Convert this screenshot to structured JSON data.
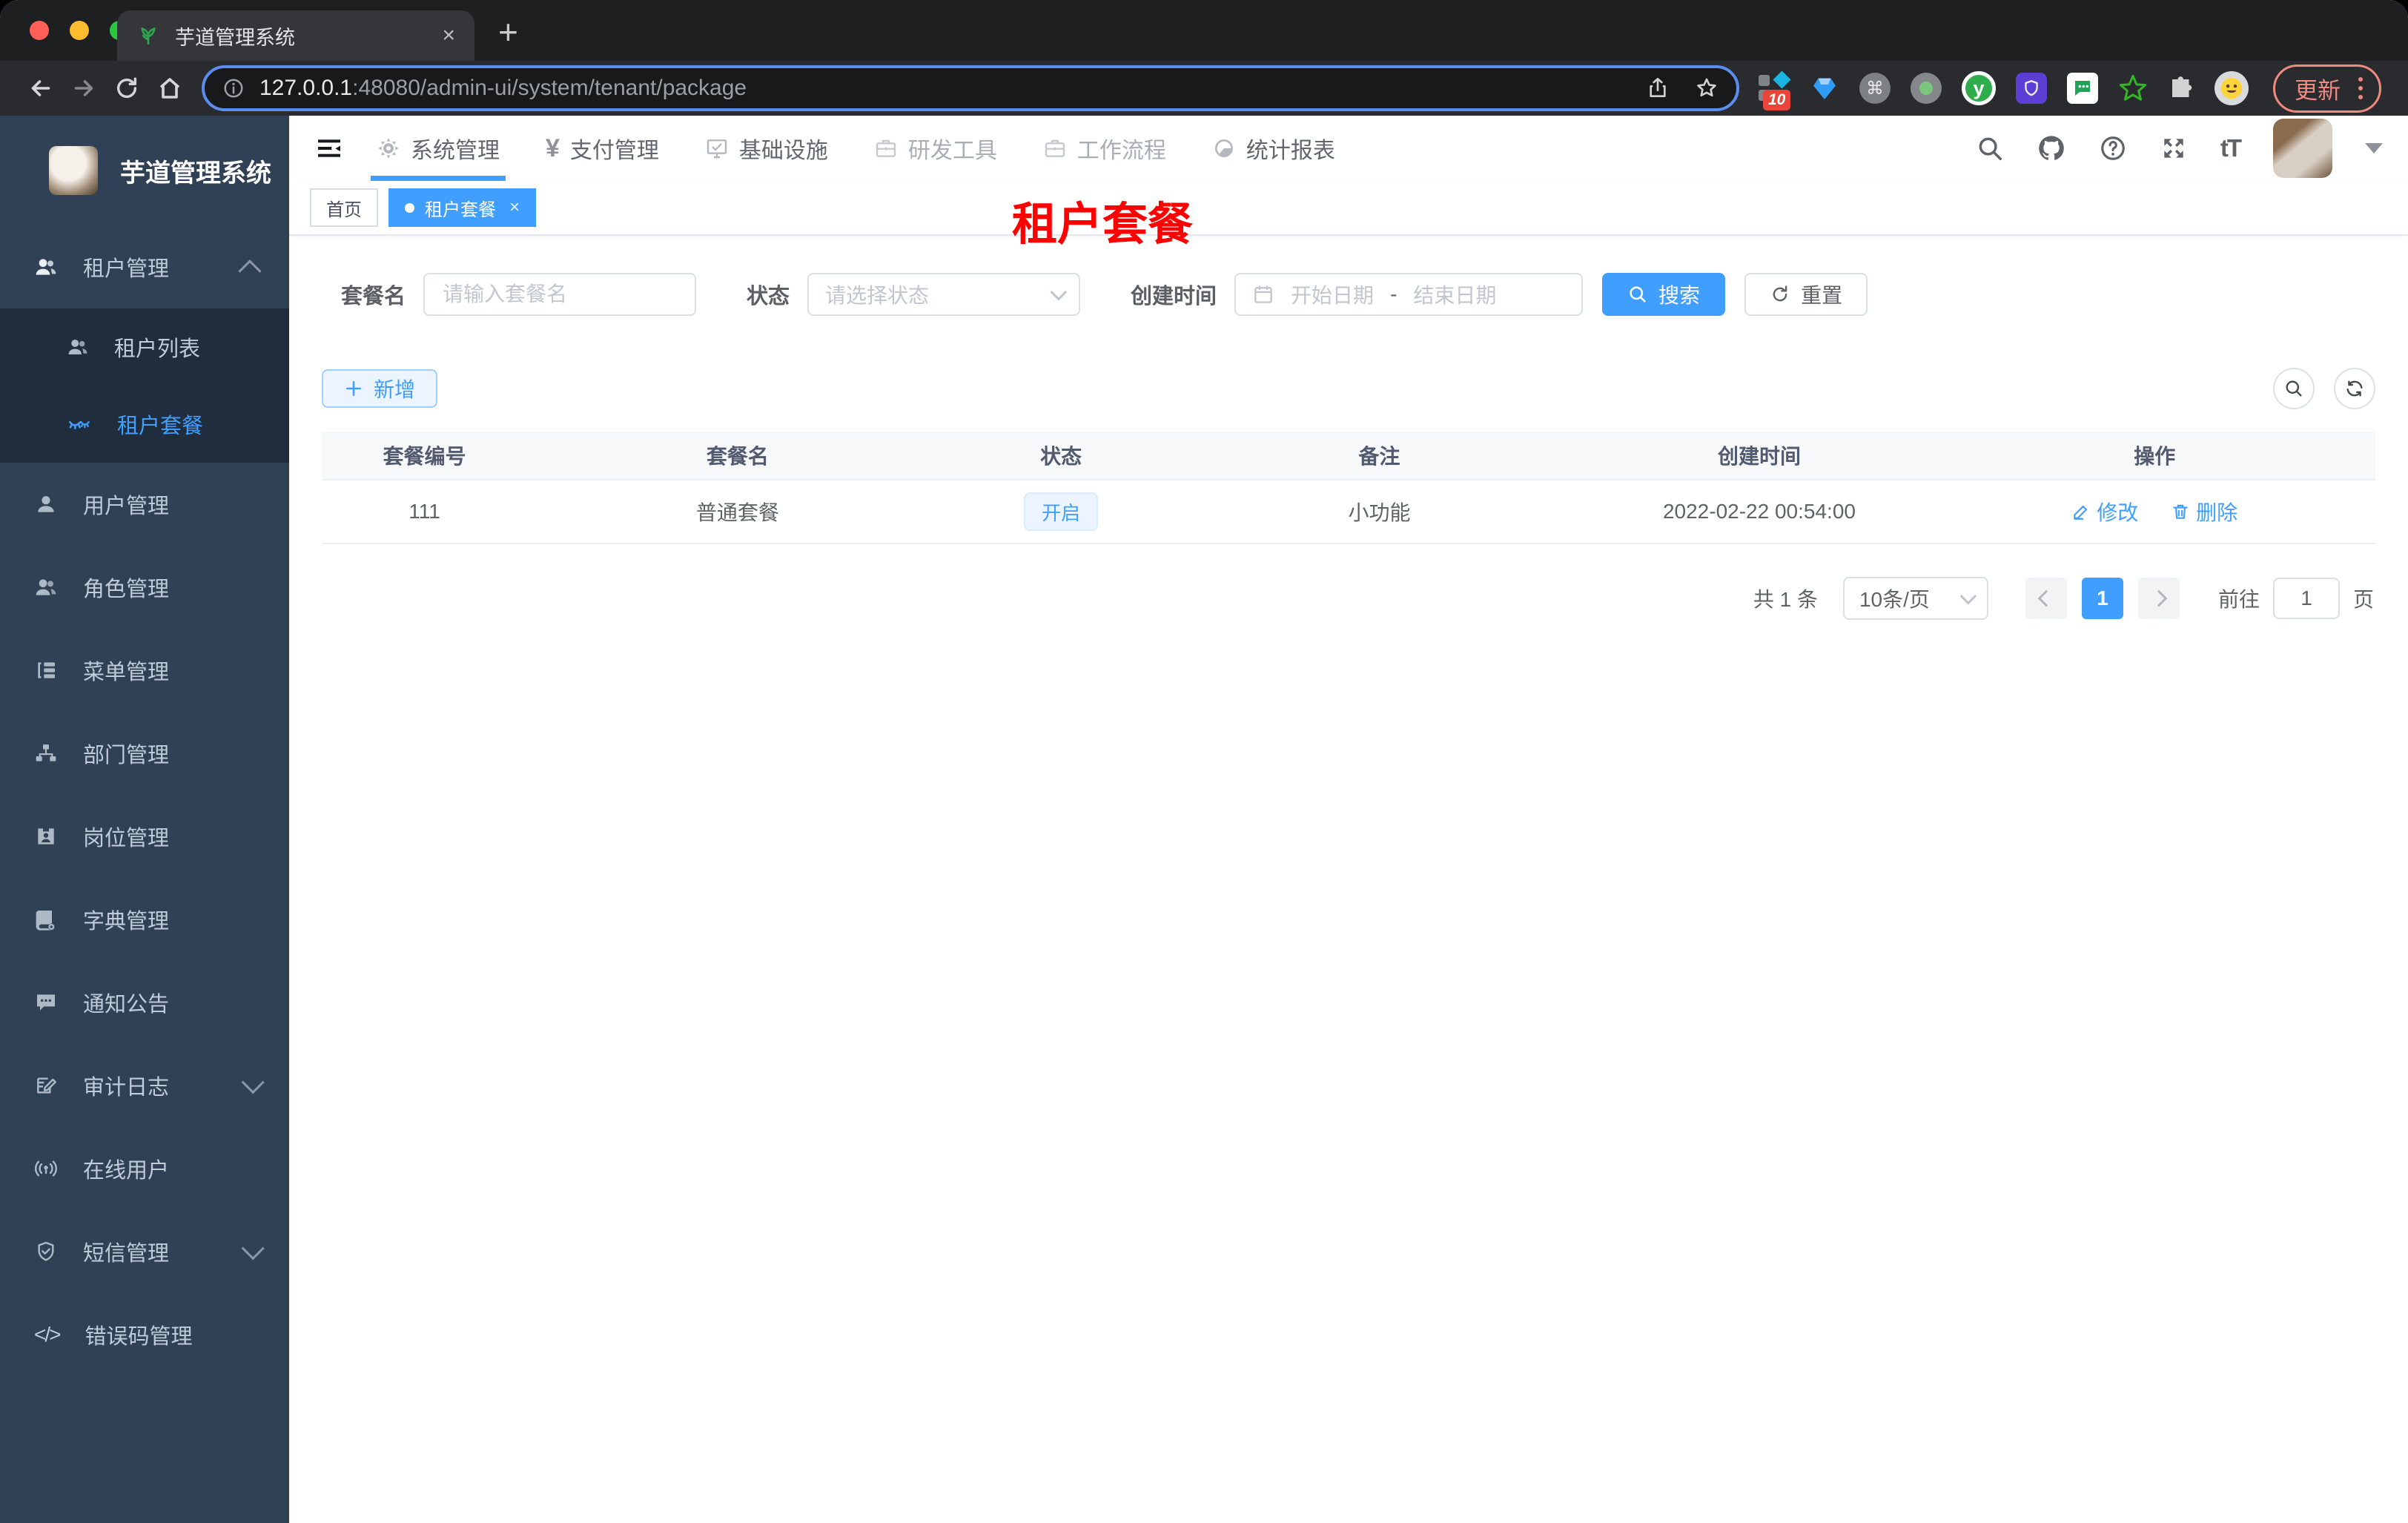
{
  "colors": {
    "accent": "#409eff",
    "sidebar_bg": "#304156",
    "submenu_bg": "#1f2d3d",
    "annotation_red": "#ff0000",
    "traffic_red": "#ff5f57",
    "traffic_yellow": "#febc2e",
    "traffic_green": "#28c840",
    "tag_light_bg": "#ecf5ff"
  },
  "browser": {
    "tab_title": "芋道管理系统",
    "url_host": "127.0.0.1",
    "url_rest": ":48080/admin-ui/system/tenant/package",
    "update_label": "更新",
    "ext_badge": "10"
  },
  "icons": {
    "yen": "¥",
    "font_size": "tT",
    "command": "⌘",
    "y_ext": "y",
    "code": "</>",
    "question": "?",
    "plus_tab": "+",
    "close_tab": "×",
    "tag_close": "×"
  },
  "sidebar": {
    "title": "芋道管理系统",
    "items": [
      {
        "label": "租户管理"
      },
      {
        "label": "租户列表"
      },
      {
        "label": "租户套餐"
      },
      {
        "label": "用户管理"
      },
      {
        "label": "角色管理"
      },
      {
        "label": "菜单管理"
      },
      {
        "label": "部门管理"
      },
      {
        "label": "岗位管理"
      },
      {
        "label": "字典管理"
      },
      {
        "label": "通知公告"
      },
      {
        "label": "审计日志"
      },
      {
        "label": "在线用户"
      },
      {
        "label": "短信管理"
      },
      {
        "label": "错误码管理"
      }
    ]
  },
  "header": {
    "nav": [
      "系统管理",
      "支付管理",
      "基础设施",
      "研发工具",
      "工作流程",
      "统计报表"
    ]
  },
  "tags": {
    "home": "首页",
    "active": "租户套餐"
  },
  "annotation": {
    "text": "租户套餐",
    "color": "#ff0000"
  },
  "filters": {
    "name_label": "套餐名",
    "name_placeholder": "请输入套餐名",
    "status_label": "状态",
    "status_placeholder": "请选择状态",
    "created_label": "创建时间",
    "start_placeholder": "开始日期",
    "range_separator": "-",
    "end_placeholder": "结束日期",
    "search_label": "搜索",
    "reset_label": "重置"
  },
  "toolbar": {
    "add_label": "新增"
  },
  "table": {
    "columns": [
      "套餐编号",
      "套餐名",
      "状态",
      "备注",
      "创建时间",
      "操作"
    ],
    "rows": [
      {
        "id": "111",
        "name": "普通套餐",
        "status": "开启",
        "remark": "小功能",
        "created": "2022-02-22 00:54:00",
        "edit": "修改",
        "delete": "删除"
      }
    ]
  },
  "pagination": {
    "total": "共 1 条",
    "page_size": "10条/页",
    "current_page": "1",
    "goto_label": "前往",
    "goto_value": "1",
    "page_unit": "页"
  }
}
